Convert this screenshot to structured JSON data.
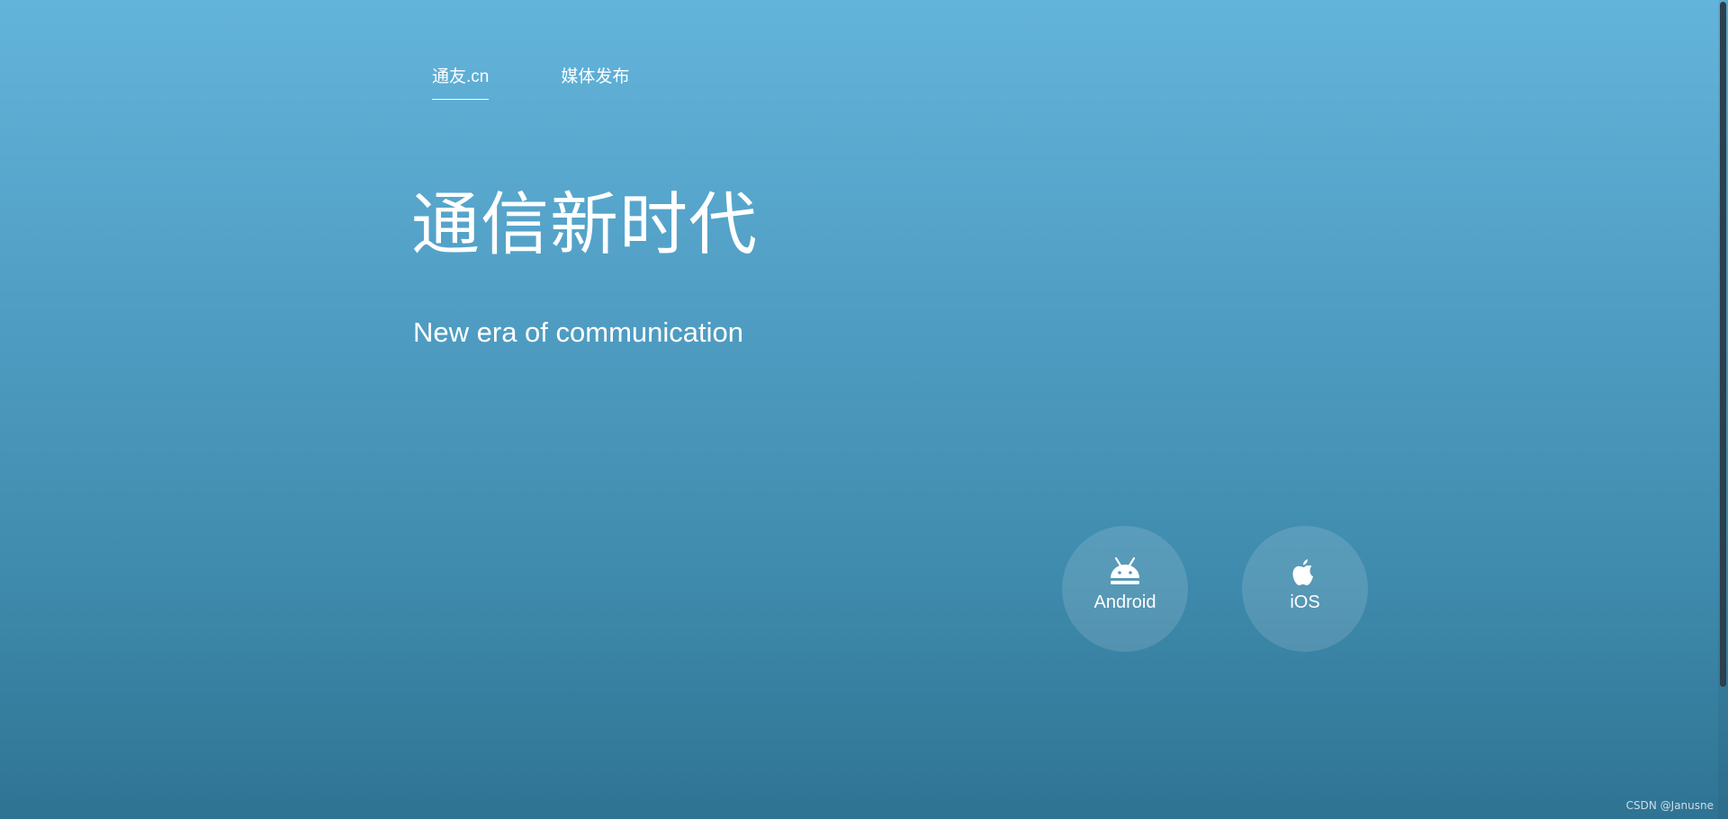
{
  "nav": {
    "items": [
      {
        "label": "通友.cn",
        "active": true
      },
      {
        "label": "媒体发布",
        "active": false
      }
    ]
  },
  "hero": {
    "title": "通信新时代",
    "subtitle": "New era of communication"
  },
  "downloads": {
    "android": {
      "label": "Android",
      "icon": "android-icon"
    },
    "ios": {
      "label": "iOS",
      "icon": "apple-icon"
    }
  },
  "watermark": "CSDN @Janusne",
  "colors": {
    "gradient_top": "#63b4db",
    "gradient_bottom": "#2f7393",
    "scrollbar_thumb": "#2c3f4c"
  }
}
